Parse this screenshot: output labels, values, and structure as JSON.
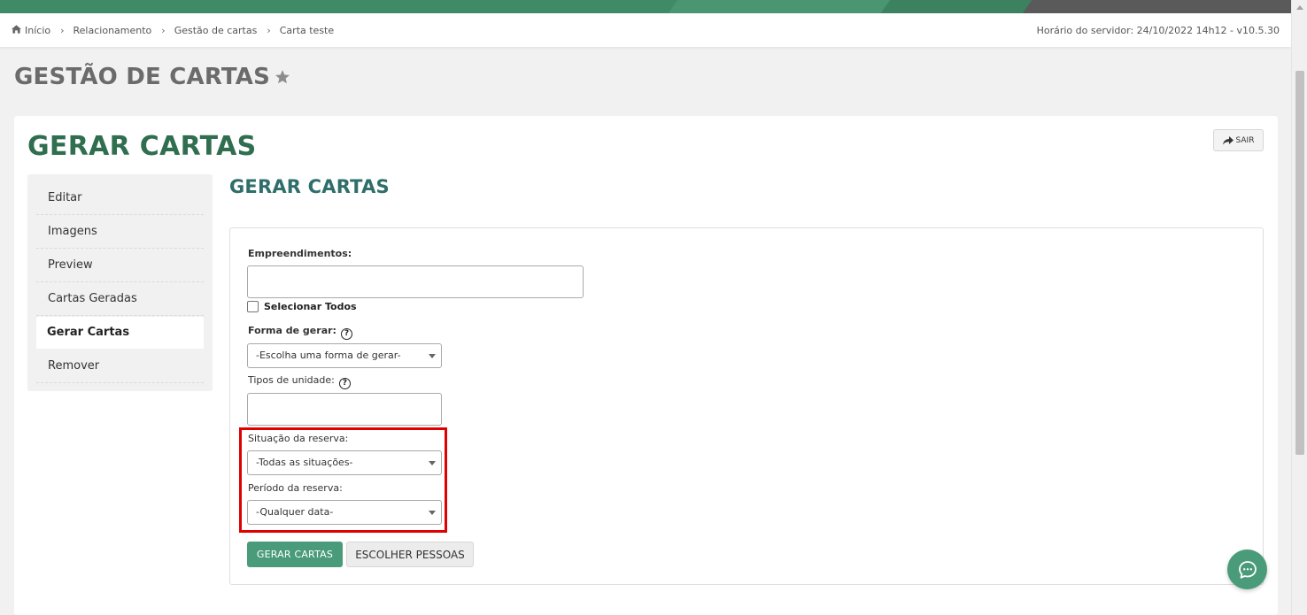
{
  "breadcrumb": {
    "items": [
      "Início",
      "Relacionamento",
      "Gestão de cartas",
      "Carta teste"
    ],
    "server_time": "Horário do servidor: 24/10/2022 14h12 - v10.5.30"
  },
  "page": {
    "title": "GESTÃO DE CARTAS"
  },
  "card": {
    "title": "GERAR CARTAS",
    "exit_label": "SAIR"
  },
  "sidebar": {
    "items": [
      {
        "label": "Editar"
      },
      {
        "label": "Imagens"
      },
      {
        "label": "Preview"
      },
      {
        "label": "Cartas Geradas"
      },
      {
        "label": "Gerar Cartas"
      },
      {
        "label": "Remover"
      }
    ],
    "active": "Gerar Cartas"
  },
  "section": {
    "title": "GERAR CARTAS"
  },
  "form": {
    "empreendimentos_label": "Empreendimentos:",
    "empreendimentos_value": "",
    "select_all_label": "Selecionar Todos",
    "forma_label": "Forma de gerar:",
    "forma_value": "-Escolha uma forma de gerar-",
    "tipos_label": "Tipos de unidade:",
    "tipos_value": "",
    "situacao_label": "Situação da reserva:",
    "situacao_value": "-Todas as situações-",
    "periodo_label": "Período da reserva:",
    "periodo_value": "-Qualquer data-",
    "help_glyph": "?",
    "generate_button": "GERAR CARTAS",
    "choose_button": "ESCOLHER PESSOAS"
  },
  "colors": {
    "brand_green": "#3f8a67",
    "title_green": "#2f6e4f",
    "button_green": "#4a9b7a",
    "highlight_red": "#e00000"
  }
}
